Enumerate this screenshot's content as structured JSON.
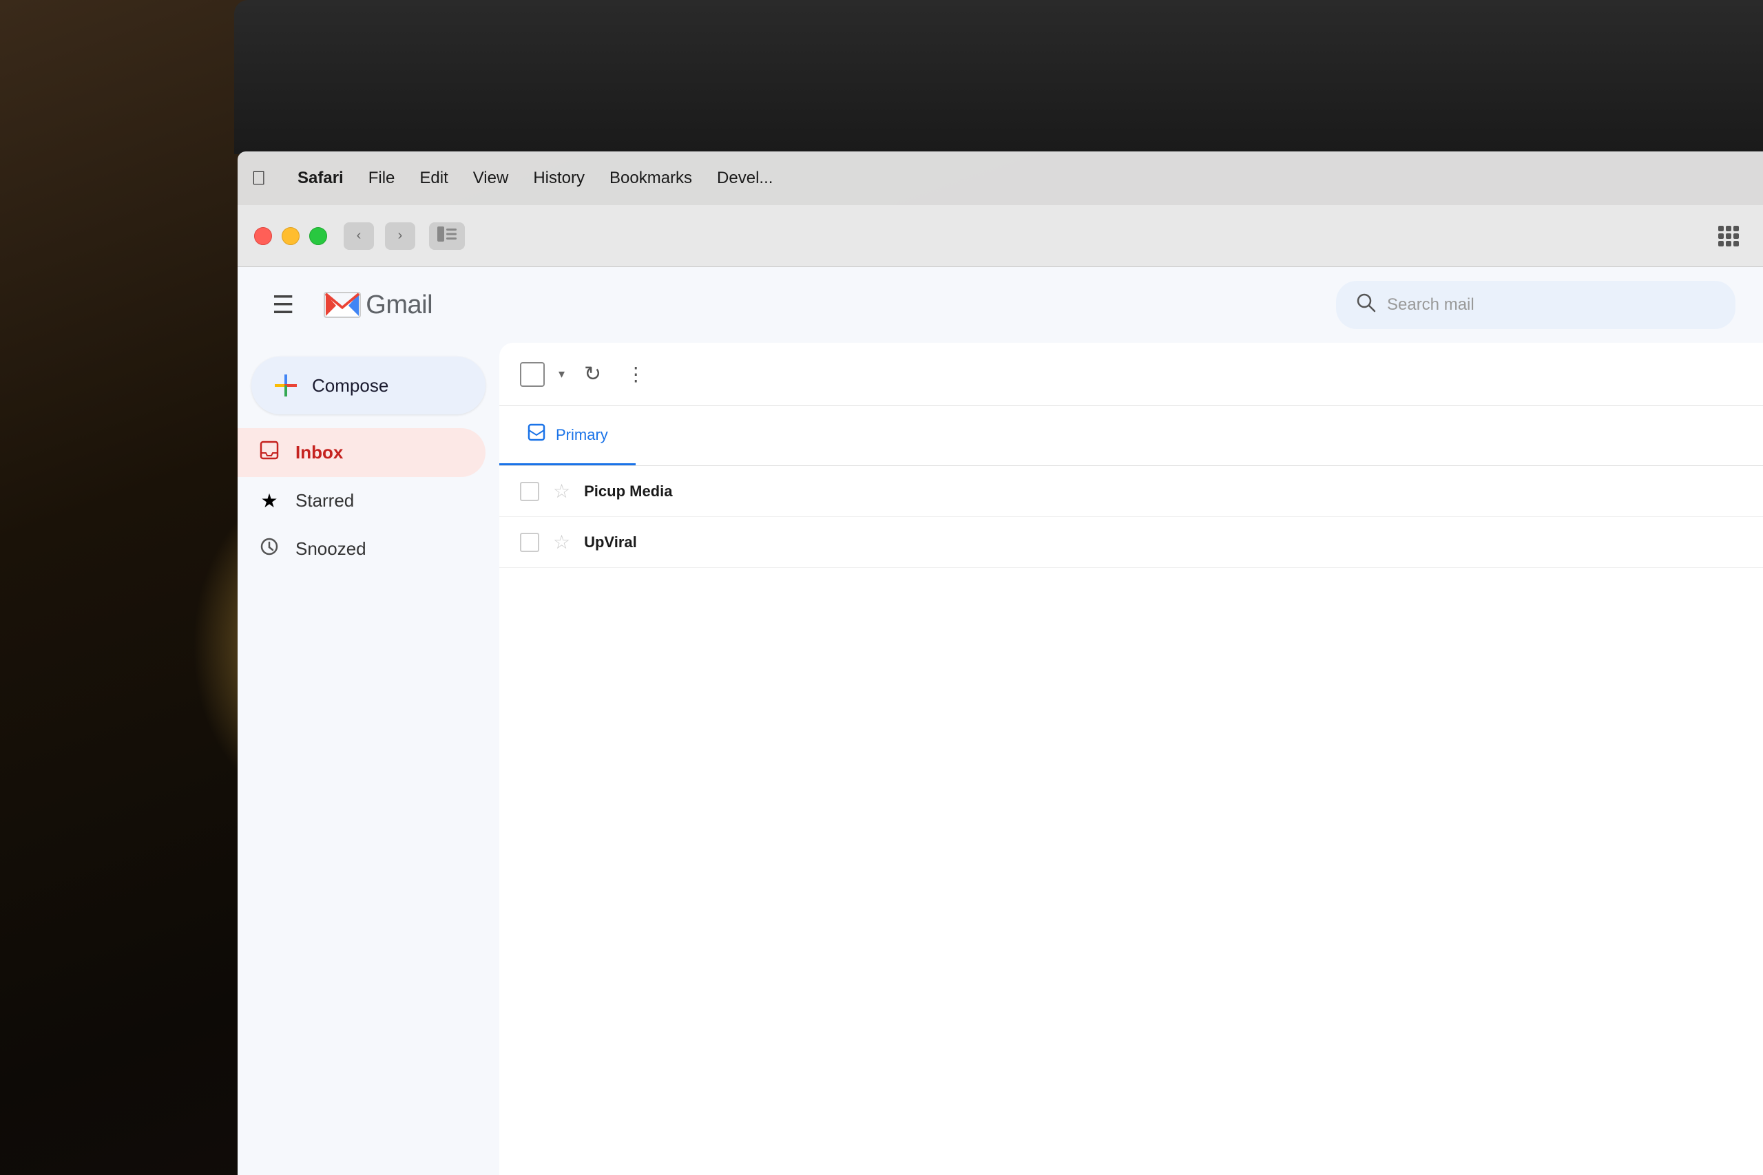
{
  "background": {
    "description": "warm bokeh background with glowing lights on left side"
  },
  "menubar": {
    "apple_label": "",
    "items": [
      {
        "label": "Safari",
        "bold": true
      },
      {
        "label": "File"
      },
      {
        "label": "Edit"
      },
      {
        "label": "View"
      },
      {
        "label": "History"
      },
      {
        "label": "Bookmarks"
      },
      {
        "label": "Devel..."
      }
    ]
  },
  "browser": {
    "back_icon": "‹",
    "forward_icon": "›",
    "sidebar_icon": "⊟"
  },
  "gmail": {
    "hamburger_label": "☰",
    "logo_text": "Gmail",
    "search_placeholder": "Search mail",
    "compose_label": "Compose",
    "sidebar_items": [
      {
        "id": "inbox",
        "label": "Inbox",
        "active": true
      },
      {
        "id": "starred",
        "label": "Starred",
        "active": false
      },
      {
        "id": "snoozed",
        "label": "Snoozed",
        "active": false
      }
    ],
    "tabs": [
      {
        "id": "primary",
        "label": "Primary",
        "active": true
      }
    ],
    "email_rows": [
      {
        "sender": "Picup Media",
        "subject": ""
      },
      {
        "sender": "UpViral",
        "subject": ""
      }
    ],
    "toolbar": {
      "more_icon": "⋮",
      "refresh_icon": "↻"
    }
  }
}
